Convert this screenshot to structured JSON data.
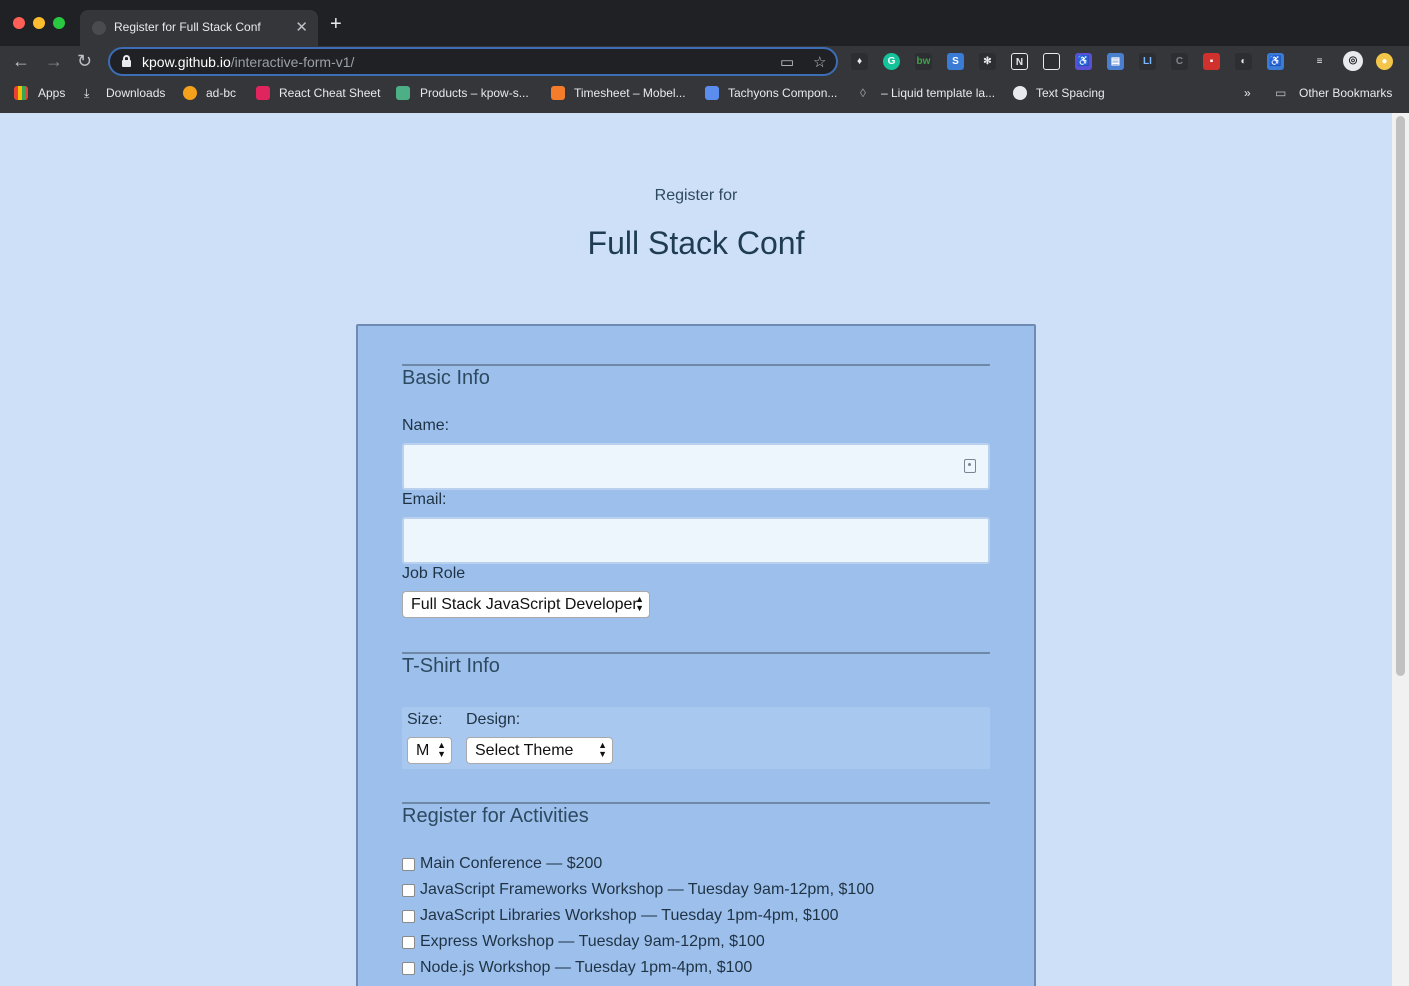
{
  "browser": {
    "tab_title": "Register for Full Stack Conf",
    "url_host": "kpow.github.io",
    "url_path": "/interactive-form-v1/",
    "bookmarks": [
      "Apps",
      "Downloads",
      "ad-bc",
      "React Cheat Sheet",
      "Products – kpow-s...",
      "Timesheet – Mobel...",
      "Tachyons Compon...",
      "– Liquid template la...",
      "Text Spacing"
    ],
    "overflow": "»",
    "other_bookmarks": "Other Bookmarks",
    "colors": {
      "tabstrip": "#202124",
      "toolbar": "#35363a",
      "omnibox_focus": "#3c6db5"
    }
  },
  "header": {
    "subtitle": "Register for",
    "title": "Full Stack Conf"
  },
  "form": {
    "basic_info": {
      "title": "Basic Info",
      "name_label": "Name:",
      "name_value": "",
      "email_label": "Email:",
      "email_value": "",
      "job_role_label": "Job Role",
      "job_role_selected": "Full Stack JavaScript Developer"
    },
    "tshirt": {
      "title": "T-Shirt Info",
      "size_label": "Size:",
      "size_selected": "M",
      "design_label": "Design:",
      "design_selected": "Select Theme"
    },
    "activities": {
      "title": "Register for Activities",
      "items": [
        "Main Conference — $200",
        "JavaScript Frameworks Workshop — Tuesday 9am-12pm, $100",
        "JavaScript Libraries Workshop — Tuesday 1pm-4pm, $100",
        "Express Workshop — Tuesday 9am-12pm, $100",
        "Node.js Workshop — Tuesday 1pm-4pm, $100"
      ]
    },
    "colors": {
      "page_bg": "#cde0f7",
      "card_bg": "#9dbfec",
      "input_bg": "#eef6fd",
      "heading": "#1f3c52"
    }
  }
}
